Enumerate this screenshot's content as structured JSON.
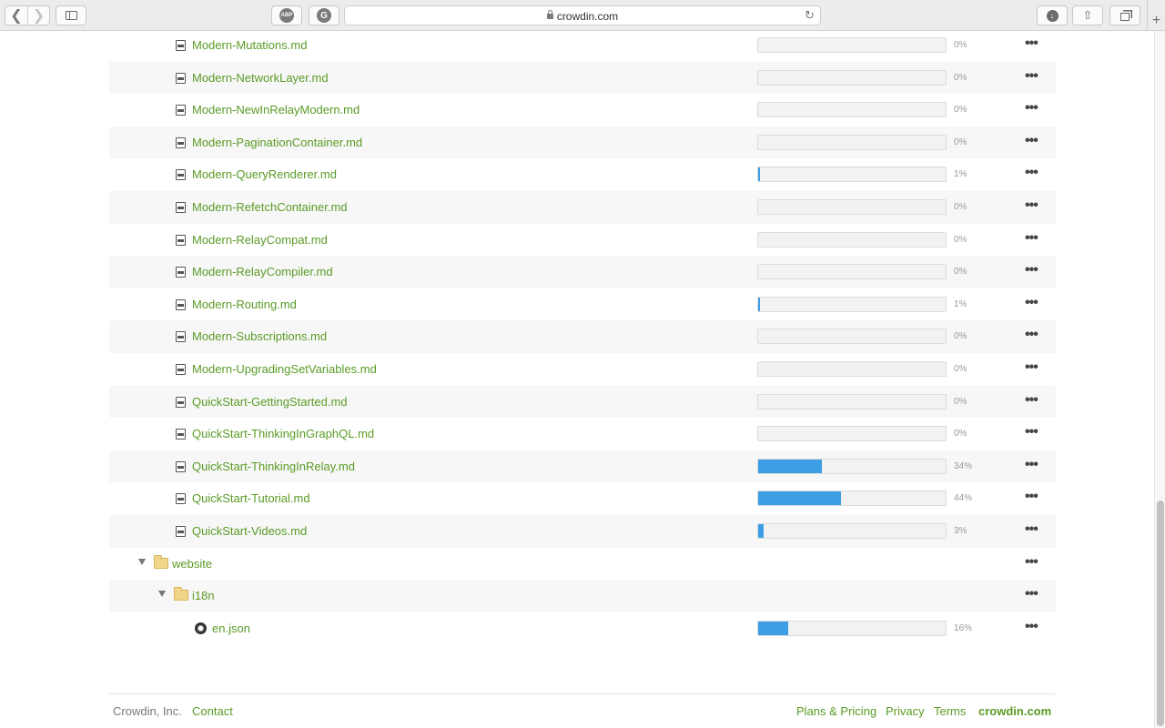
{
  "browser": {
    "url": "crowdin.com",
    "adblock_label": "ABP",
    "grammarly_label": "G"
  },
  "files": [
    {
      "name": "Modern-Mutations.md",
      "progress": 0,
      "progress_label": "0%"
    },
    {
      "name": "Modern-NetworkLayer.md",
      "progress": 0,
      "progress_label": "0%"
    },
    {
      "name": "Modern-NewInRelayModern.md",
      "progress": 0,
      "progress_label": "0%"
    },
    {
      "name": "Modern-PaginationContainer.md",
      "progress": 0,
      "progress_label": "0%"
    },
    {
      "name": "Modern-QueryRenderer.md",
      "progress": 1,
      "progress_label": "1%"
    },
    {
      "name": "Modern-RefetchContainer.md",
      "progress": 0,
      "progress_label": "0%"
    },
    {
      "name": "Modern-RelayCompat.md",
      "progress": 0,
      "progress_label": "0%"
    },
    {
      "name": "Modern-RelayCompiler.md",
      "progress": 0,
      "progress_label": "0%"
    },
    {
      "name": "Modern-Routing.md",
      "progress": 1,
      "progress_label": "1%"
    },
    {
      "name": "Modern-Subscriptions.md",
      "progress": 0,
      "progress_label": "0%"
    },
    {
      "name": "Modern-UpgradingSetVariables.md",
      "progress": 0,
      "progress_label": "0%"
    },
    {
      "name": "QuickStart-GettingStarted.md",
      "progress": 0,
      "progress_label": "0%"
    },
    {
      "name": "QuickStart-ThinkingInGraphQL.md",
      "progress": 0,
      "progress_label": "0%"
    },
    {
      "name": "QuickStart-ThinkingInRelay.md",
      "progress": 34,
      "progress_label": "34%"
    },
    {
      "name": "QuickStart-Tutorial.md",
      "progress": 44,
      "progress_label": "44%"
    },
    {
      "name": "QuickStart-Videos.md",
      "progress": 3,
      "progress_label": "3%"
    }
  ],
  "folders": {
    "website": {
      "name": "website"
    },
    "i18n": {
      "name": "i18n"
    }
  },
  "json_file": {
    "name": "en.json",
    "progress": 16,
    "progress_label": "16%"
  },
  "more_label": "•••",
  "footer": {
    "company": "Crowdin, Inc.",
    "contact": "Contact",
    "plans": "Plans & Pricing",
    "privacy": "Privacy",
    "terms": "Terms",
    "brand": "crowdin.com"
  },
  "colors": {
    "link": "#5a9b25",
    "progress_fill": "#3d9ee6",
    "progress_track": "#f2f2f2"
  }
}
